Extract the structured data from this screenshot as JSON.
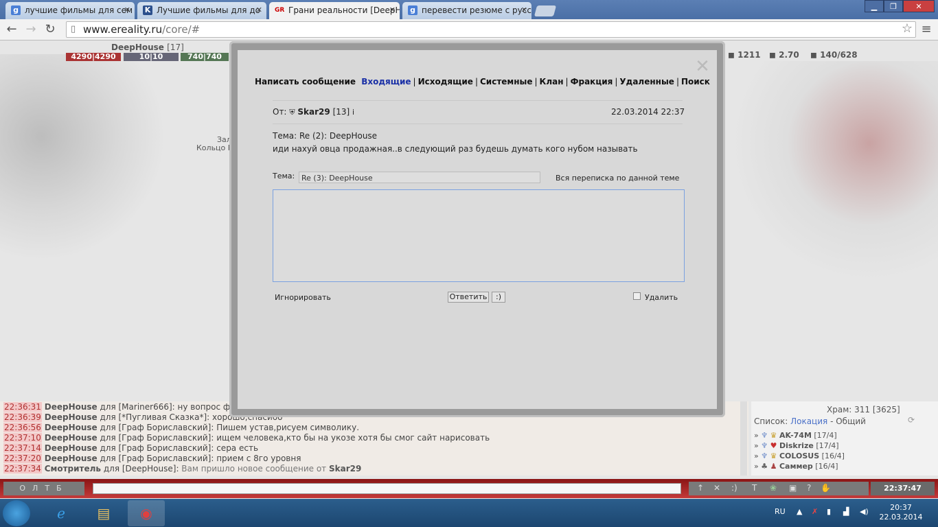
{
  "browser": {
    "tabs": [
      {
        "label": "лучшие фильмы для сем",
        "favicon": "g"
      },
      {
        "label": "Лучшие фильмы для до",
        "favicon": "K"
      },
      {
        "label": "Грани реальности [DeepH",
        "favicon": "GR"
      },
      {
        "label": "перевести резюме с русс",
        "favicon": "g"
      }
    ],
    "url_host": "www.ereality.ru",
    "url_path": "/core/#"
  },
  "game": {
    "char_name": "DeepHouse",
    "char_level": "[17]",
    "hp": "4290|4290",
    "mana": "10|10",
    "energy": "740|740",
    "res1": "1211",
    "res2": "2.70",
    "res3": "140/628",
    "side_text1": "Зал",
    "side_text2": "Кольцо Ра"
  },
  "modal": {
    "nav": {
      "write": "Написать сообщение",
      "inbox": "Входящие",
      "outbox": "Исходящие",
      "system": "Системные",
      "clan": "Клан",
      "faction": "Фракция",
      "deleted": "Удаленные",
      "search": "Поиск"
    },
    "from_label": "От:",
    "sender": "Skar29",
    "sender_level": "[13]",
    "datetime": "22.03.2014 22:37",
    "subject_line": "Тема: Re (2): DeepHouse",
    "body": "иди нахуй овца продажная..в следующий раз будешь думать кого нубом называть",
    "subject_label": "Тема:",
    "subject_value": "Re (3): DeepHouse",
    "thread_link": "Вся переписка по данной теме",
    "ignore": "Игнорировать",
    "reply_btn": "Ответить",
    "smile_btn": ":)",
    "delete_label": "Удалить"
  },
  "chat": [
    {
      "time": "22:36:31",
      "name": "DeepHouse",
      "text": " для [Mariner666]: ну вопрос фил"
    },
    {
      "time": "22:36:39",
      "name": "DeepHouse",
      "text": " для [*Пугливая Сказка*]: хорошо,спасибо"
    },
    {
      "time": "22:36:56",
      "name": "DeepHouse",
      "text": " для [Граф Бориславский]: Пишем устав,рисуем символику."
    },
    {
      "time": "22:37:10",
      "name": "DeepHouse",
      "text": " для [Граф Бориславский]: ищем человека,кто бы на укозе хотя бы смог сайт нарисовать"
    },
    {
      "time": "22:37:14",
      "name": "DeepHouse",
      "text": " для [Граф Бориславский]: сера есть"
    },
    {
      "time": "22:37:20",
      "name": "DeepHouse",
      "text": " для [Граф Бориславский]: прием с 8го уровня"
    },
    {
      "time": "22:37:34",
      "name": "Смотритель",
      "text": " для [DeepHouse]: ",
      "sys": "Вам пришло новое сообщение от ",
      "sysname": "Skar29"
    }
  ],
  "rpanel": {
    "location": "Храм: 311 [3625]",
    "list_label": "Список:",
    "list_link": "Локация",
    "list_rest": "- Общий",
    "users": [
      {
        "name": "AK-74M",
        "lvl": "[17/4]"
      },
      {
        "name": "Diskrize",
        "lvl": "[17/4]"
      },
      {
        "name": "COLOSUS",
        "lvl": "[16/4]"
      },
      {
        "name": "Саммер",
        "lvl": "[16/4]"
      }
    ]
  },
  "bottombar": {
    "left_letters": "ОЛТБ",
    "clock": "22:37:47"
  },
  "taskbar": {
    "lang": "RU",
    "time": "20:37",
    "date": "22.03.2014"
  }
}
